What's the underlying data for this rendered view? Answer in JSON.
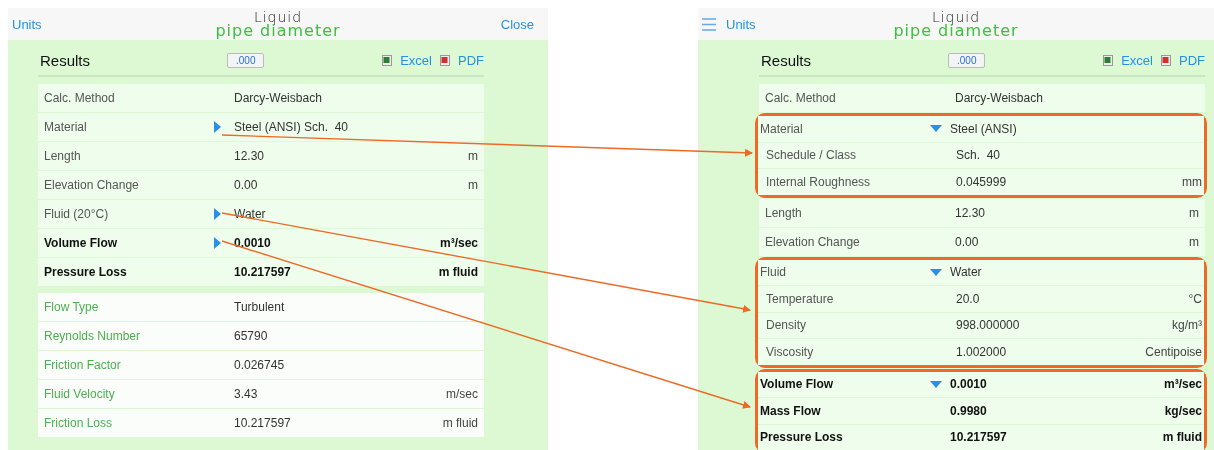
{
  "panels": [
    {
      "nav": {
        "menu": false,
        "left_link": "Units",
        "right_link": "Close",
        "logo": [
          "Liquid",
          "pipe diameter"
        ]
      },
      "results": {
        "title": "Results",
        "decimals": ".000",
        "exports": [
          {
            "kind": "excel",
            "label": "Excel"
          },
          {
            "kind": "pdf",
            "label": "PDF"
          }
        ]
      },
      "cards": [
        {
          "groups": [
            {
              "highlighted": false,
              "rows": [
                {
                  "kind": "input",
                  "label": "Calc. Method",
                  "value": "Darcy-Weisbach"
                },
                {
                  "kind": "input",
                  "label": "Material",
                  "value": "Steel (ANSI) Sch.  40",
                  "expanded": false
                },
                {
                  "kind": "input",
                  "label": "Length",
                  "value": "12.30",
                  "unit": "m"
                },
                {
                  "kind": "input",
                  "label": "Elevation Change",
                  "value": "0.00",
                  "unit": "m"
                },
                {
                  "kind": "input",
                  "label": "Fluid (20°C)",
                  "value": "Water",
                  "expanded": false
                },
                {
                  "kind": "bold",
                  "label": "Volume Flow",
                  "value": "0.0010",
                  "unit": "m³/sec",
                  "expanded": false
                },
                {
                  "kind": "bold",
                  "label": "Pressure Loss",
                  "value": "10.217597",
                  "unit": "m fluid"
                }
              ]
            }
          ]
        },
        {
          "groups": [
            {
              "highlighted": false,
              "rows": [
                {
                  "kind": "result",
                  "label": "Flow Type",
                  "value": "Turbulent"
                },
                {
                  "kind": "result",
                  "label": "Reynolds Number",
                  "value": "65790"
                },
                {
                  "kind": "result",
                  "label": "Friction Factor",
                  "value": "0.026745"
                },
                {
                  "kind": "result",
                  "label": "Fluid Velocity",
                  "value": "3.43",
                  "unit": "m/sec"
                },
                {
                  "kind": "result",
                  "label": "Friction Loss",
                  "value": "10.217597",
                  "unit": "m fluid"
                }
              ]
            }
          ]
        }
      ]
    },
    {
      "nav": {
        "menu": true,
        "left_link": "Units",
        "logo": [
          "Liquid",
          "pipe diameter"
        ]
      },
      "results": {
        "title": "Results",
        "decimals": ".000",
        "exports": [
          {
            "kind": "excel",
            "label": "Excel"
          },
          {
            "kind": "pdf",
            "label": "PDF"
          }
        ]
      },
      "cards": [
        {
          "groups": [
            {
              "highlighted": false,
              "rows": [
                {
                  "kind": "input",
                  "label": "Calc. Method",
                  "value": "Darcy-Weisbach"
                }
              ]
            },
            {
              "highlighted": true,
              "rows": [
                {
                  "kind": "input",
                  "label": "Material",
                  "value": "Steel (ANSI)",
                  "expanded": true
                },
                {
                  "kind": "sub",
                  "label": "Schedule / Class",
                  "value": "Sch.  40"
                },
                {
                  "kind": "sub",
                  "label": "Internal Roughness",
                  "value": "0.045999",
                  "unit": "mm"
                }
              ]
            },
            {
              "highlighted": false,
              "rows": [
                {
                  "kind": "input",
                  "label": "Length",
                  "value": "12.30",
                  "unit": "m"
                },
                {
                  "kind": "input",
                  "label": "Elevation Change",
                  "value": "0.00",
                  "unit": "m"
                }
              ]
            },
            {
              "highlighted": true,
              "rows": [
                {
                  "kind": "input",
                  "label": "Fluid",
                  "value": "Water",
                  "expanded": true
                },
                {
                  "kind": "sub",
                  "label": "Temperature",
                  "value": "20.0",
                  "unit": "°C"
                },
                {
                  "kind": "sub",
                  "label": "Density",
                  "value": "998.000000",
                  "unit": "kg/m³"
                },
                {
                  "kind": "sub",
                  "label": "Viscosity",
                  "value": "1.002000",
                  "unit": "Centipoise"
                }
              ]
            },
            {
              "highlighted": true,
              "rows": [
                {
                  "kind": "bold",
                  "label": "Volume Flow",
                  "value": "0.0010",
                  "unit": "m³/sec",
                  "expanded": true
                },
                {
                  "kind": "bold",
                  "label": "Mass Flow",
                  "value": "0.9980",
                  "unit": "kg/sec"
                },
                {
                  "kind": "bold",
                  "label": "Pressure Loss",
                  "value": "10.217597",
                  "unit": "m fluid"
                }
              ]
            }
          ]
        }
      ]
    }
  ]
}
